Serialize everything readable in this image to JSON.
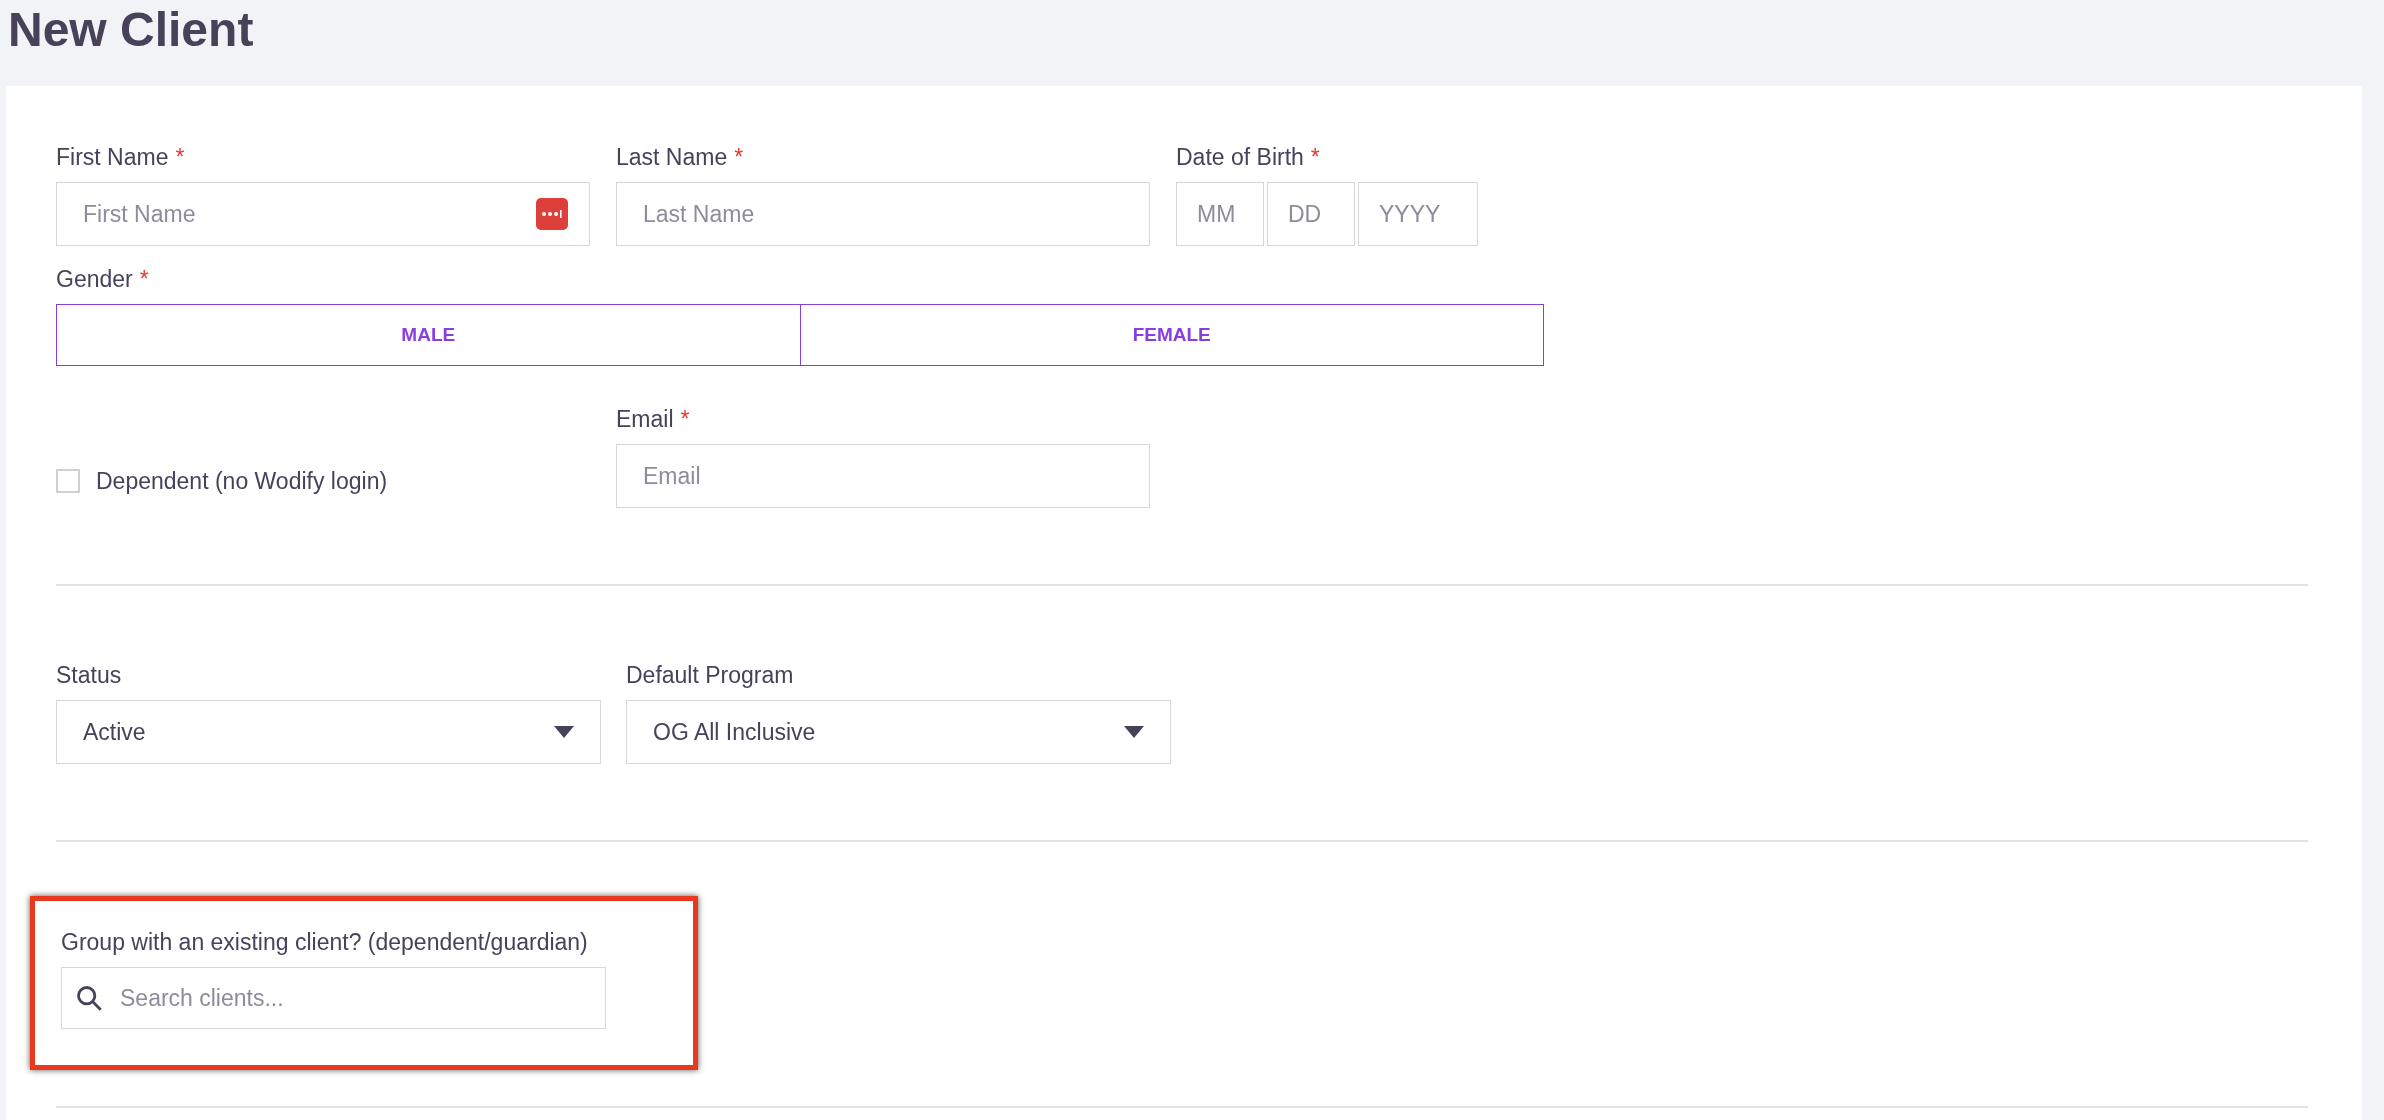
{
  "page_title": "New Client",
  "first_name": {
    "label": "First Name",
    "required_mark": "*",
    "placeholder": "First Name"
  },
  "last_name": {
    "label": "Last Name",
    "required_mark": "*",
    "placeholder": "Last Name"
  },
  "date_of_birth": {
    "label": "Date of Birth",
    "required_mark": "*",
    "parts": [
      {
        "placeholder": "MM"
      },
      {
        "placeholder": "DD"
      },
      {
        "placeholder": "YYYY"
      }
    ]
  },
  "gender": {
    "label": "Gender",
    "required_mark": "*",
    "options": [
      {
        "label": "MALE",
        "selected": false
      },
      {
        "label": "FEMALE",
        "selected": false
      }
    ]
  },
  "dependent": {
    "label": "Dependent (no Wodify login)",
    "checked": false
  },
  "email": {
    "label": "Email",
    "required_mark": "*",
    "placeholder": "Email"
  },
  "status": {
    "label": "Status",
    "value": "Active"
  },
  "default_program": {
    "label": "Default Program",
    "value": "OG All Inclusive"
  },
  "group": {
    "label": "Group with an existing client? (dependent/guardian)",
    "placeholder": "Search clients...",
    "highlighted": true
  }
}
